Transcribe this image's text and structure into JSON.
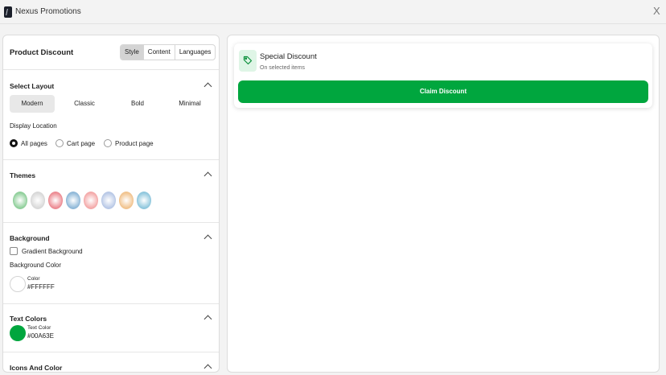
{
  "app": {
    "title": "Nexus Promotions",
    "close_label": "X"
  },
  "left_panel": {
    "title": "Product Discount",
    "tabs": [
      "Style",
      "Content",
      "Languages"
    ],
    "active_tab": "Style",
    "layout": {
      "title": "Select Layout",
      "options": [
        "Modern",
        "Classic",
        "Bold",
        "Minimal"
      ],
      "selected": "Modern",
      "display_location_label": "Display Location",
      "locations": [
        "All pages",
        "Cart page",
        "Product page"
      ],
      "selected_location": "All pages"
    },
    "themes": {
      "title": "Themes",
      "swatches": [
        "#8fcf9a",
        "#d8d8d8",
        "#ec8a92",
        "#8fb8d8",
        "#f4a9a9",
        "#b8c8e6",
        "#f1c38e",
        "#8fc7dd"
      ]
    },
    "background": {
      "title": "Background",
      "gradient_label": "Gradient Background",
      "gradient_checked": false,
      "color_label": "Background Color",
      "color_small_label": "Color",
      "color_hex": "#FFFFFF"
    },
    "text_colors": {
      "title": "Text Colors",
      "color_small_label": "Text Color",
      "color_hex": "#00A63E"
    },
    "icons": {
      "title": "Icons And Color"
    }
  },
  "preview": {
    "title": "Special Discount",
    "subtitle": "On selected items",
    "button_label": "Claim Discount",
    "accent": "#00A63E",
    "icon": "tag-icon"
  }
}
